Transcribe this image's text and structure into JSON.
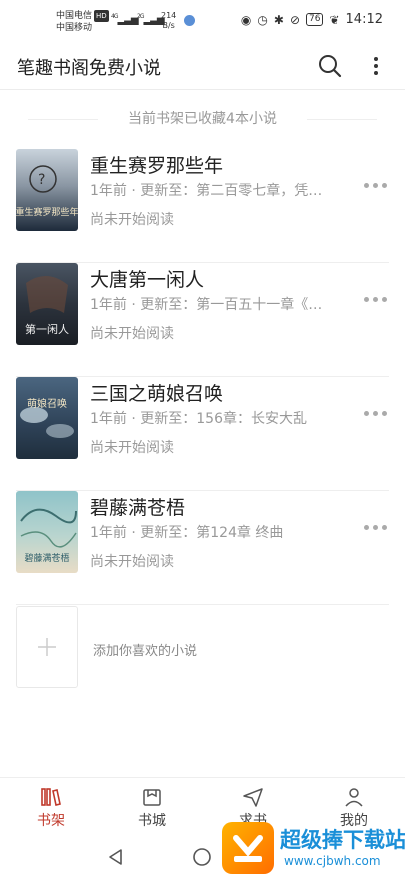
{
  "status_bar": {
    "carrier1": "中国电信",
    "carrier1_badge": "HD",
    "carrier2": "中国移动",
    "signal1": "4G",
    "signal2": "2G",
    "speed_value": "214",
    "speed_unit": "B/s",
    "battery": "76",
    "time": "14:12",
    "icons": [
      "eye-icon",
      "alarm-icon",
      "bluetooth-icon",
      "mute-icon",
      "battery-icon",
      "leaf-icon"
    ]
  },
  "header": {
    "title": "笔趣书阁免费小说",
    "icons": [
      "search-icon",
      "more-vertical-icon"
    ]
  },
  "shelf_info": "当前书架已收藏4本小说",
  "books": [
    {
      "title": "重生赛罗那些年",
      "update": "1年前 · 更新至：第二百零七章，凭…",
      "progress": "尚未开始阅读",
      "cover_text": "重生赛罗那些年",
      "cover_colors": [
        "#c9d3dc",
        "#1d2a3a"
      ]
    },
    {
      "title": "大唐第一闲人",
      "update": "1年前 · 更新至：第一百五十一章《…",
      "progress": "尚未开始阅读",
      "cover_text": "第一闲人",
      "cover_colors": [
        "#4a5563",
        "#1a1e24"
      ]
    },
    {
      "title": "三国之萌娘召唤",
      "update": "1年前 · 更新至：156章：长安大乱",
      "progress": "尚未开始阅读",
      "cover_text": "萌娘召唤",
      "cover_colors": [
        "#4b6680",
        "#1f2e3d"
      ]
    },
    {
      "title": "碧藤满苍梧",
      "update": "1年前 · 更新至：第124章 终曲",
      "progress": "尚未开始阅读",
      "cover_text": "碧藤满苍梧",
      "cover_colors": [
        "#8fc3c9",
        "#e8dcc6"
      ]
    }
  ],
  "add_book": {
    "label": "添加你喜欢的小说"
  },
  "bottom_nav": [
    {
      "label": "书架",
      "icon": "bookshelf-icon",
      "active": true
    },
    {
      "label": "书城",
      "icon": "bookstore-icon",
      "active": false
    },
    {
      "label": "求书",
      "icon": "send-icon",
      "active": false
    },
    {
      "label": "我的",
      "icon": "profile-icon",
      "active": false
    }
  ],
  "system_nav": [
    "back-icon",
    "home-icon",
    "recents-icon"
  ],
  "watermark": {
    "text": "超级捧下载站",
    "url": "www.cjbwh.com"
  },
  "colors": {
    "accent": "#c0392b",
    "muted_text": "#999999",
    "divider": "#eeeeee"
  }
}
